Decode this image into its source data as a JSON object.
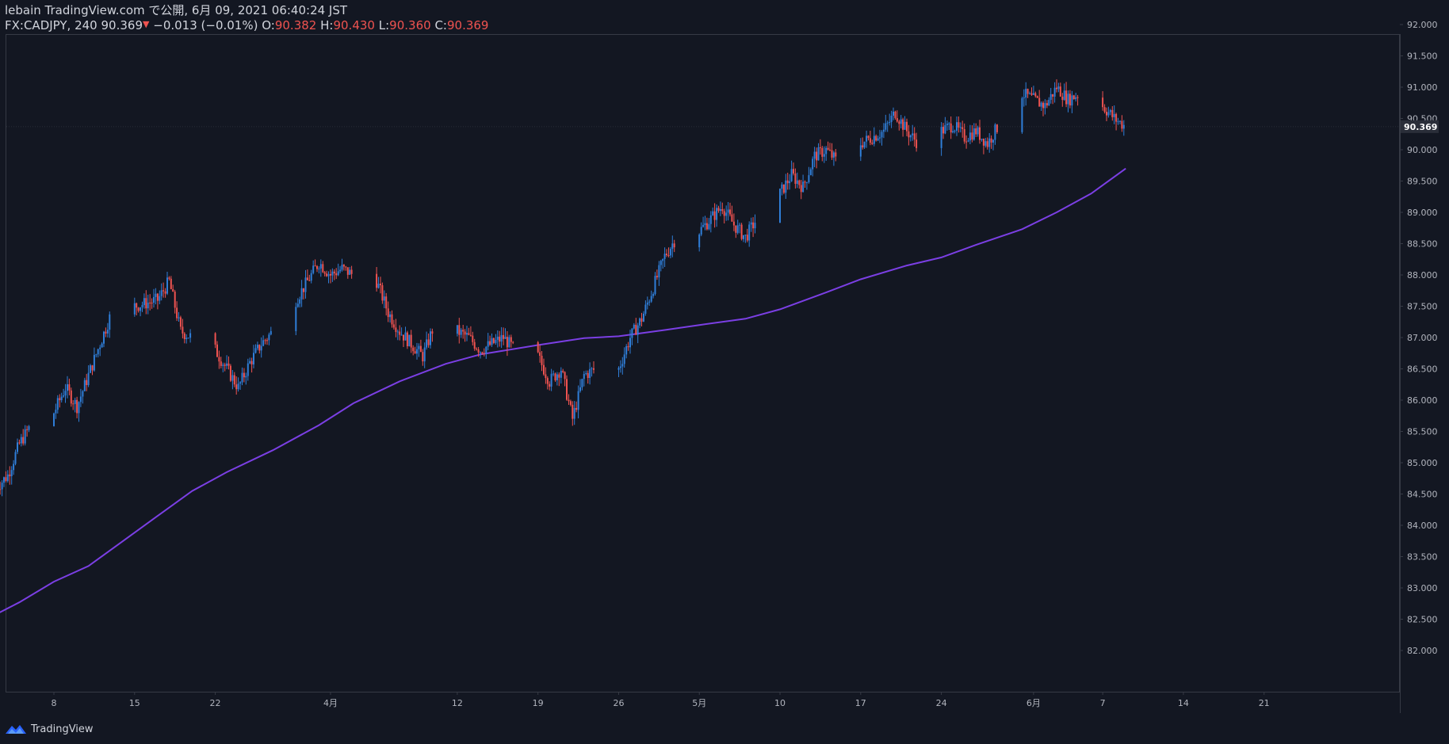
{
  "header": {
    "published_line": "lebain TradingView.com で公開, 6月 09, 2021 06:40:24 JST",
    "symbol": "FX:CADJPY, 240",
    "last": "90.369",
    "change": "−0.013 (−0.01%)",
    "o_label": "O:",
    "o_value": "90.382",
    "h_label": "H:",
    "h_value": "90.430",
    "l_label": "L:",
    "l_value": "90.360",
    "c_label": "C:",
    "c_value": "90.369"
  },
  "colors": {
    "background": "#131722",
    "up": "#2f7ed8",
    "down": "#ef5350",
    "ma": "#7b3fe4",
    "text": "#d1d4dc",
    "axis_text": "#b2b5be",
    "frame": "#363a45",
    "price_tag_bg": "#2a2e39"
  },
  "footer": {
    "brand": "TradingView",
    "icon": "tradingview-logo-icon"
  },
  "chart_data": {
    "type": "candlestick",
    "symbol": "FX:CADJPY",
    "interval": "240",
    "y_ticks": [
      "82.000",
      "82.500",
      "83.000",
      "83.500",
      "84.000",
      "84.500",
      "85.000",
      "85.500",
      "86.000",
      "86.500",
      "87.000",
      "87.500",
      "88.000",
      "88.500",
      "89.000",
      "89.500",
      "90.000",
      "90.500",
      "91.000",
      "91.500",
      "92.000"
    ],
    "ylim": [
      81.7,
      92.25
    ],
    "x_ticks": [
      {
        "label": "8",
        "date": "2021-03-08"
      },
      {
        "label": "15",
        "date": "2021-03-15"
      },
      {
        "label": "22",
        "date": "2021-03-22"
      },
      {
        "label": "4月",
        "date": "2021-04-01"
      },
      {
        "label": "12",
        "date": "2021-04-12"
      },
      {
        "label": "19",
        "date": "2021-04-19"
      },
      {
        "label": "26",
        "date": "2021-04-26"
      },
      {
        "label": "5月",
        "date": "2021-05-03"
      },
      {
        "label": "10",
        "date": "2021-05-10"
      },
      {
        "label": "17",
        "date": "2021-05-17"
      },
      {
        "label": "24",
        "date": "2021-05-24"
      },
      {
        "label": "6月",
        "date": "2021-06-01"
      },
      {
        "label": "7",
        "date": "2021-06-07"
      },
      {
        "label": "14",
        "date": "2021-06-14"
      },
      {
        "label": "21",
        "date": "2021-06-21"
      }
    ],
    "current_price": "90.369",
    "close_path": [
      [
        "2021-03-03",
        84.6
      ],
      [
        "2021-03-04",
        84.8
      ],
      [
        "2021-03-05",
        85.3
      ],
      [
        "2021-03-06",
        85.6
      ],
      [
        "2021-03-08",
        85.8
      ],
      [
        "2021-03-09",
        86.2
      ],
      [
        "2021-03-10",
        85.9
      ],
      [
        "2021-03-11",
        86.4
      ],
      [
        "2021-03-12",
        86.9
      ],
      [
        "2021-03-13",
        87.4
      ],
      [
        "2021-03-14",
        87.6
      ],
      [
        "2021-03-15",
        87.5
      ],
      [
        "2021-03-17",
        87.6
      ],
      [
        "2021-03-18",
        87.9
      ],
      [
        "2021-03-19",
        87.1
      ],
      [
        "2021-03-20",
        87.0
      ],
      [
        "2021-03-22",
        86.8
      ],
      [
        "2021-03-23",
        86.5
      ],
      [
        "2021-03-24",
        86.2
      ],
      [
        "2021-03-25",
        86.6
      ],
      [
        "2021-03-26",
        86.9
      ],
      [
        "2021-03-27",
        87.1
      ],
      [
        "2021-03-28",
        87.2
      ],
      [
        "2021-03-29",
        87.6
      ],
      [
        "2021-03-31",
        88.2
      ],
      [
        "2021-04-01",
        88.0
      ],
      [
        "2021-04-02",
        88.1
      ],
      [
        "2021-04-03",
        88.0
      ],
      [
        "2021-04-05",
        87.9
      ],
      [
        "2021-04-06",
        87.4
      ],
      [
        "2021-04-07",
        87.1
      ],
      [
        "2021-04-08",
        86.9
      ],
      [
        "2021-04-09",
        86.7
      ],
      [
        "2021-04-10",
        87.2
      ],
      [
        "2021-04-11",
        87.5
      ],
      [
        "2021-04-12",
        87.1
      ],
      [
        "2021-04-13",
        87.0
      ],
      [
        "2021-04-14",
        86.8
      ],
      [
        "2021-04-15",
        86.9
      ],
      [
        "2021-04-16",
        87.0
      ],
      [
        "2021-04-17",
        86.8
      ],
      [
        "2021-04-18",
        86.9
      ],
      [
        "2021-04-19",
        86.7
      ],
      [
        "2021-04-20",
        86.3
      ],
      [
        "2021-04-21",
        86.5
      ],
      [
        "2021-04-22",
        85.7
      ],
      [
        "2021-04-23",
        86.4
      ],
      [
        "2021-04-24",
        86.5
      ],
      [
        "2021-04-25",
        86.3
      ],
      [
        "2021-04-26",
        86.5
      ],
      [
        "2021-04-27",
        87.0
      ],
      [
        "2021-04-28",
        87.3
      ],
      [
        "2021-04-29",
        87.8
      ],
      [
        "2021-04-30",
        88.3
      ],
      [
        "2021-05-01",
        88.6
      ],
      [
        "2021-05-03",
        88.7
      ],
      [
        "2021-05-04",
        88.9
      ],
      [
        "2021-05-05",
        89.1
      ],
      [
        "2021-05-06",
        88.8
      ],
      [
        "2021-05-07",
        88.6
      ],
      [
        "2021-05-08",
        88.9
      ],
      [
        "2021-05-09",
        89.0
      ],
      [
        "2021-05-10",
        89.3
      ],
      [
        "2021-05-11",
        89.6
      ],
      [
        "2021-05-12",
        89.4
      ],
      [
        "2021-05-13",
        89.9
      ],
      [
        "2021-05-14",
        90.0
      ],
      [
        "2021-05-15",
        89.8
      ],
      [
        "2021-05-16",
        90.5
      ],
      [
        "2021-05-17",
        90.1
      ],
      [
        "2021-05-18",
        90.2
      ],
      [
        "2021-05-19",
        90.3
      ],
      [
        "2021-05-20",
        90.6
      ],
      [
        "2021-05-21",
        90.3
      ],
      [
        "2021-05-22",
        90.1
      ],
      [
        "2021-05-23",
        90.2
      ],
      [
        "2021-05-24",
        90.3
      ],
      [
        "2021-05-25",
        90.4
      ],
      [
        "2021-05-26",
        90.2
      ],
      [
        "2021-05-27",
        90.3
      ],
      [
        "2021-05-28",
        90.1
      ],
      [
        "2021-05-29",
        90.4
      ],
      [
        "2021-05-30",
        90.9
      ],
      [
        "2021-05-31",
        90.9
      ],
      [
        "2021-06-01",
        90.8
      ],
      [
        "2021-06-02",
        90.7
      ],
      [
        "2021-06-03",
        91.0
      ],
      [
        "2021-06-04",
        90.8
      ],
      [
        "2021-06-05",
        90.9
      ],
      [
        "2021-06-06",
        91.0
      ],
      [
        "2021-06-07",
        90.7
      ],
      [
        "2021-06-08",
        90.5
      ],
      [
        "2021-06-09",
        90.369
      ]
    ],
    "moving_average": [
      [
        "2021-03-03",
        82.58
      ],
      [
        "2021-03-05",
        82.77
      ],
      [
        "2021-03-08",
        83.1
      ],
      [
        "2021-03-11",
        83.35
      ],
      [
        "2021-03-14",
        83.75
      ],
      [
        "2021-03-17",
        84.15
      ],
      [
        "2021-03-20",
        84.55
      ],
      [
        "2021-03-23",
        84.85
      ],
      [
        "2021-03-27",
        85.2
      ],
      [
        "2021-03-31",
        85.6
      ],
      [
        "2021-04-03",
        85.95
      ],
      [
        "2021-04-07",
        86.3
      ],
      [
        "2021-04-11",
        86.58
      ],
      [
        "2021-04-14",
        86.73
      ],
      [
        "2021-04-19",
        86.88
      ],
      [
        "2021-04-23",
        86.99
      ],
      [
        "2021-04-26",
        87.02
      ],
      [
        "2021-04-30",
        87.12
      ],
      [
        "2021-05-03",
        87.2
      ],
      [
        "2021-05-07",
        87.3
      ],
      [
        "2021-05-10",
        87.45
      ],
      [
        "2021-05-14",
        87.72
      ],
      [
        "2021-05-17",
        87.93
      ],
      [
        "2021-05-21",
        88.15
      ],
      [
        "2021-05-24",
        88.28
      ],
      [
        "2021-05-27",
        88.48
      ],
      [
        "2021-05-31",
        88.73
      ],
      [
        "2021-06-03",
        89.0
      ],
      [
        "2021-06-06",
        89.3
      ],
      [
        "2021-06-09",
        89.7
      ]
    ]
  }
}
